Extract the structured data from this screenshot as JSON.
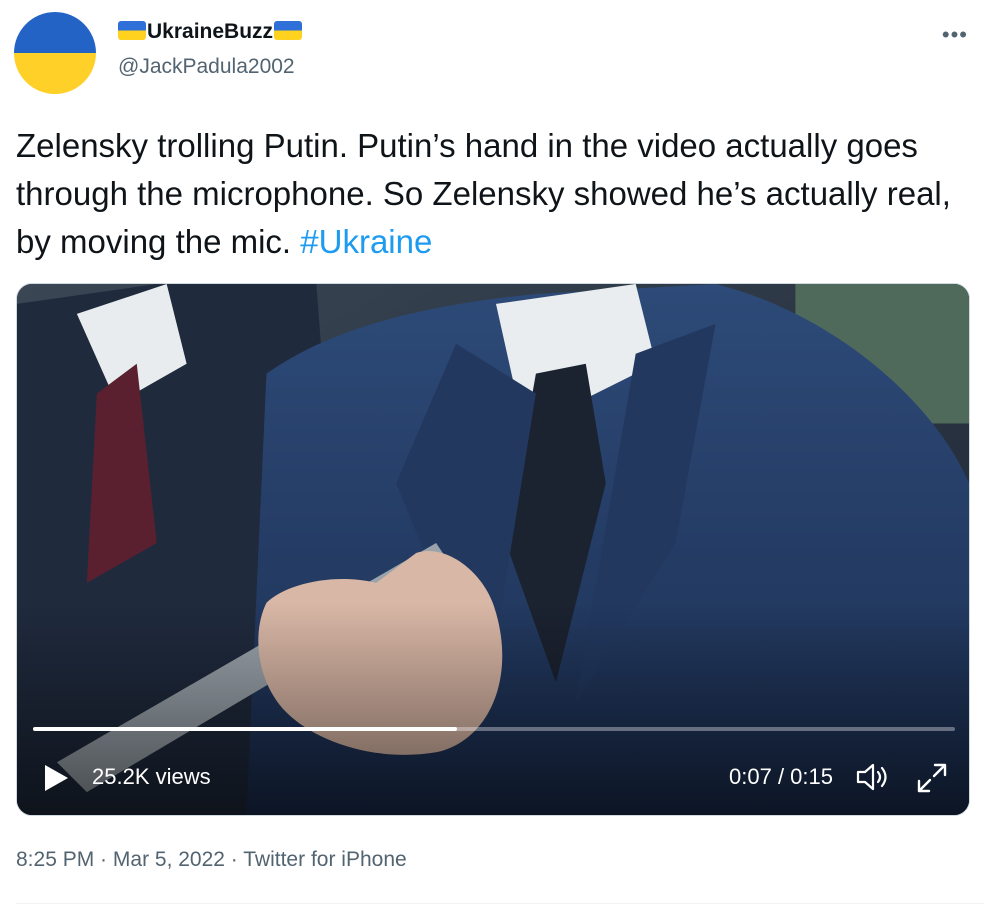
{
  "author": {
    "display_name": "UkraineBuzz",
    "handle": "@JackPadula2002",
    "avatar_colors": [
      "#2463c6",
      "#ffd028"
    ],
    "flag_emoji": "ukraine-flag-icon"
  },
  "menu": {
    "more_label": "•••"
  },
  "tweet": {
    "text": "Zelensky trolling Putin. Putin’s hand in the video actually goes through the microphone. So Zelensky showed he’s actually real, by moving the mic. ",
    "hashtag": "#Ukraine"
  },
  "video": {
    "views": "25.2K views",
    "time": "0:07 / 0:15",
    "progress_fraction": 0.46
  },
  "meta": {
    "time": "8:25 PM",
    "separator": " · ",
    "date": "Mar 5, 2022",
    "source": "Twitter for iPhone"
  },
  "colors": {
    "link": "#1d9bf0",
    "secondary_text": "#536471"
  }
}
